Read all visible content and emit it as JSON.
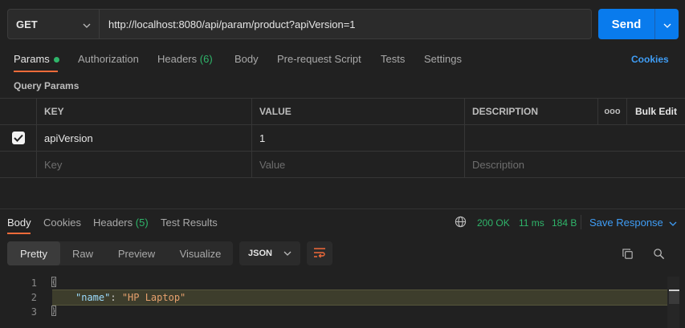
{
  "request": {
    "method": "GET",
    "url": "http://localhost:8080/api/param/product?apiVersion=1",
    "send_label": "Send"
  },
  "request_tabs": [
    {
      "label": "Params"
    },
    {
      "label": "Authorization"
    },
    {
      "label": "Headers",
      "count": "(6)"
    },
    {
      "label": "Body"
    },
    {
      "label": "Pre-request Script"
    },
    {
      "label": "Tests"
    },
    {
      "label": "Settings"
    }
  ],
  "cookies_link": "Cookies",
  "query_params": {
    "title": "Query Params",
    "columns": {
      "key": "KEY",
      "value": "VALUE",
      "description": "DESCRIPTION",
      "more": "ooo",
      "bulk_edit": "Bulk Edit"
    },
    "rows": [
      {
        "checked": true,
        "key": "apiVersion",
        "value": "1",
        "description": ""
      }
    ],
    "placeholders": {
      "key": "Key",
      "value": "Value",
      "description": "Description"
    }
  },
  "response": {
    "tabs": [
      {
        "label": "Body"
      },
      {
        "label": "Cookies"
      },
      {
        "label": "Headers",
        "count": "(5)"
      },
      {
        "label": "Test Results"
      }
    ],
    "status": "200 OK",
    "time": "11 ms",
    "size": "184 B",
    "save_label": "Save Response",
    "views": [
      "Pretty",
      "Raw",
      "Preview",
      "Visualize"
    ],
    "format": "JSON",
    "body_lines": [
      {
        "num": "1",
        "text": "{"
      },
      {
        "num": "2",
        "key": "\"name\"",
        "sep": ": ",
        "value": "\"HP Laptop\""
      },
      {
        "num": "3",
        "text": "}"
      }
    ]
  },
  "colors": {
    "accent": "#097bed",
    "tab_underline": "#f26b3a",
    "success": "#2fb56a",
    "link": "#3f9df5"
  }
}
